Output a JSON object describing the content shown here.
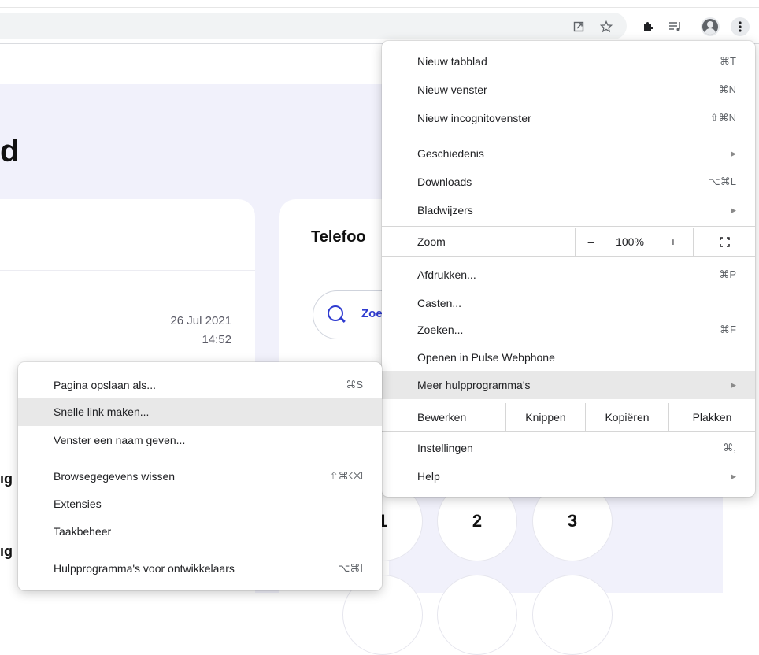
{
  "menu": {
    "new_tab": {
      "label": "Nieuw tabblad",
      "shortcut": "⌘T"
    },
    "new_window": {
      "label": "Nieuw venster",
      "shortcut": "⌘N"
    },
    "new_incognito": {
      "label": "Nieuw incognitovenster",
      "shortcut": "⇧⌘N"
    },
    "history": {
      "label": "Geschiedenis"
    },
    "downloads": {
      "label": "Downloads",
      "shortcut": "⌥⌘L"
    },
    "bookmarks": {
      "label": "Bladwijzers"
    },
    "zoom": {
      "label": "Zoom",
      "minus": "–",
      "value": "100%",
      "plus": "+",
      "fullscreen_icon": "fullscreen-icon"
    },
    "print": {
      "label": "Afdrukken...",
      "shortcut": "⌘P"
    },
    "cast": {
      "label": "Casten..."
    },
    "find": {
      "label": "Zoeken...",
      "shortcut": "⌘F"
    },
    "open_in": {
      "label": "Openen in Pulse Webphone"
    },
    "more_tools": {
      "label": "Meer hulpprogramma's"
    },
    "edit": {
      "label": "Bewerken",
      "cut": "Knippen",
      "copy": "Kopiëren",
      "paste": "Plakken"
    },
    "settings": {
      "label": "Instellingen",
      "shortcut": "⌘,"
    },
    "help": {
      "label": "Help"
    }
  },
  "submenu": {
    "save_page": {
      "label": "Pagina opslaan als...",
      "shortcut": "⌘S"
    },
    "quick_link": {
      "label": "Snelle link maken..."
    },
    "name_window": {
      "label": "Venster een naam geven..."
    },
    "clear_data": {
      "label": "Browsegegevens wissen",
      "shortcut": "⇧⌘⌫"
    },
    "extensions": {
      "label": "Extensies"
    },
    "task_manager": {
      "label": "Taakbeheer"
    },
    "dev_tools": {
      "label": "Hulpprogramma's voor ontwikkelaars",
      "shortcut": "⌥⌘I"
    }
  },
  "page": {
    "heading_fragment": "d",
    "date": "26 Jul 2021",
    "time": "14:52",
    "phone_title": "Telefoo",
    "search_fragment": "Zoe",
    "left_fragment_1": "ıg",
    "left_fragment_2": "ıg",
    "dial_1": "1",
    "dial_2": "2",
    "dial_3": "3"
  },
  "icons": {
    "toolbar": [
      "share-icon",
      "bookmark-star-icon",
      "extensions-icon",
      "reading-list-icon",
      "profile-icon",
      "more-vertical-icon"
    ]
  },
  "colors": {
    "accent": "#2f3bd0",
    "page_bg": "#f1f1fb",
    "menu_highlight": "#e8e8e8"
  }
}
